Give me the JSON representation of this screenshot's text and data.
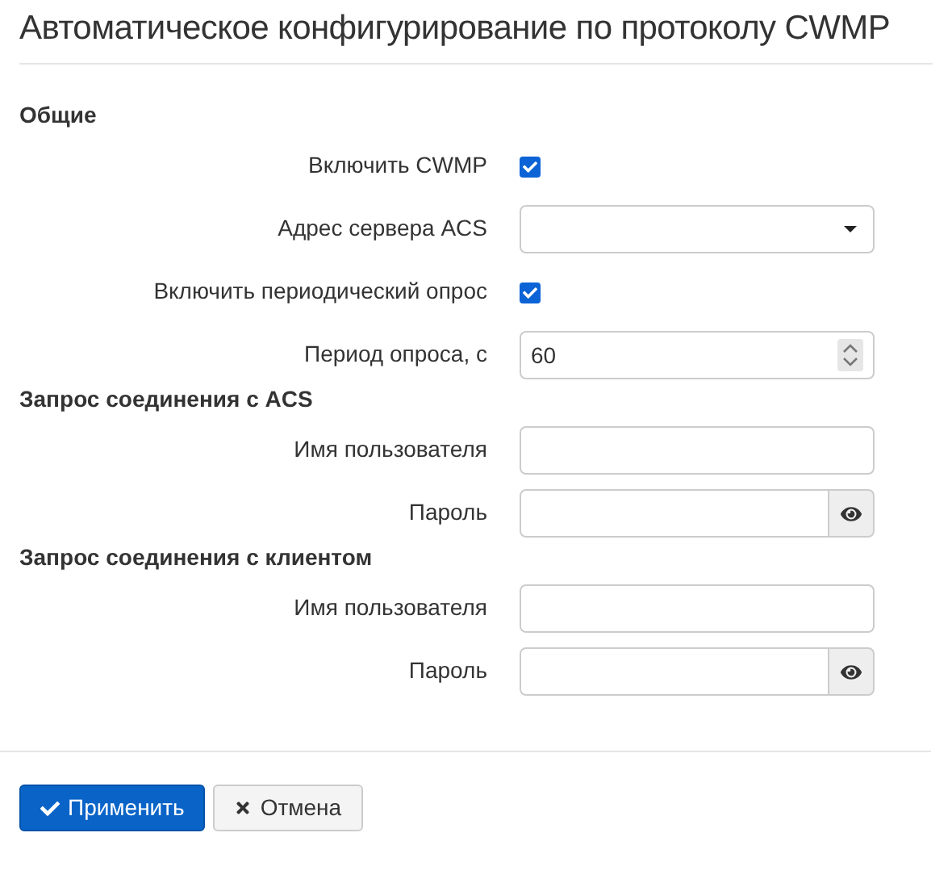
{
  "title": "Автоматическое конфигурирование по протоколу CWMP",
  "sections": [
    {
      "heading": "Общие",
      "fields": [
        {
          "kind": "checkbox",
          "label": "Включить CWMP",
          "checked": true
        },
        {
          "kind": "select",
          "label": "Адрес сервера ACS"
        },
        {
          "kind": "checkbox",
          "label": "Включить периодический опрос",
          "checked": true
        },
        {
          "kind": "number",
          "label": "Период опроса, с",
          "value": "60"
        }
      ]
    },
    {
      "heading": "Запрос соединения с ACS",
      "fields": [
        {
          "kind": "text",
          "label": "Имя пользователя"
        },
        {
          "kind": "password",
          "label": "Пароль"
        }
      ]
    },
    {
      "heading": "Запрос соединения с клиентом",
      "fields": [
        {
          "kind": "text",
          "label": "Имя пользователя"
        },
        {
          "kind": "password",
          "label": "Пароль"
        }
      ]
    }
  ],
  "buttons": [
    {
      "kind": "primary",
      "label": "Применить"
    },
    {
      "kind": "cancel",
      "label": "Отмена"
    }
  ]
}
